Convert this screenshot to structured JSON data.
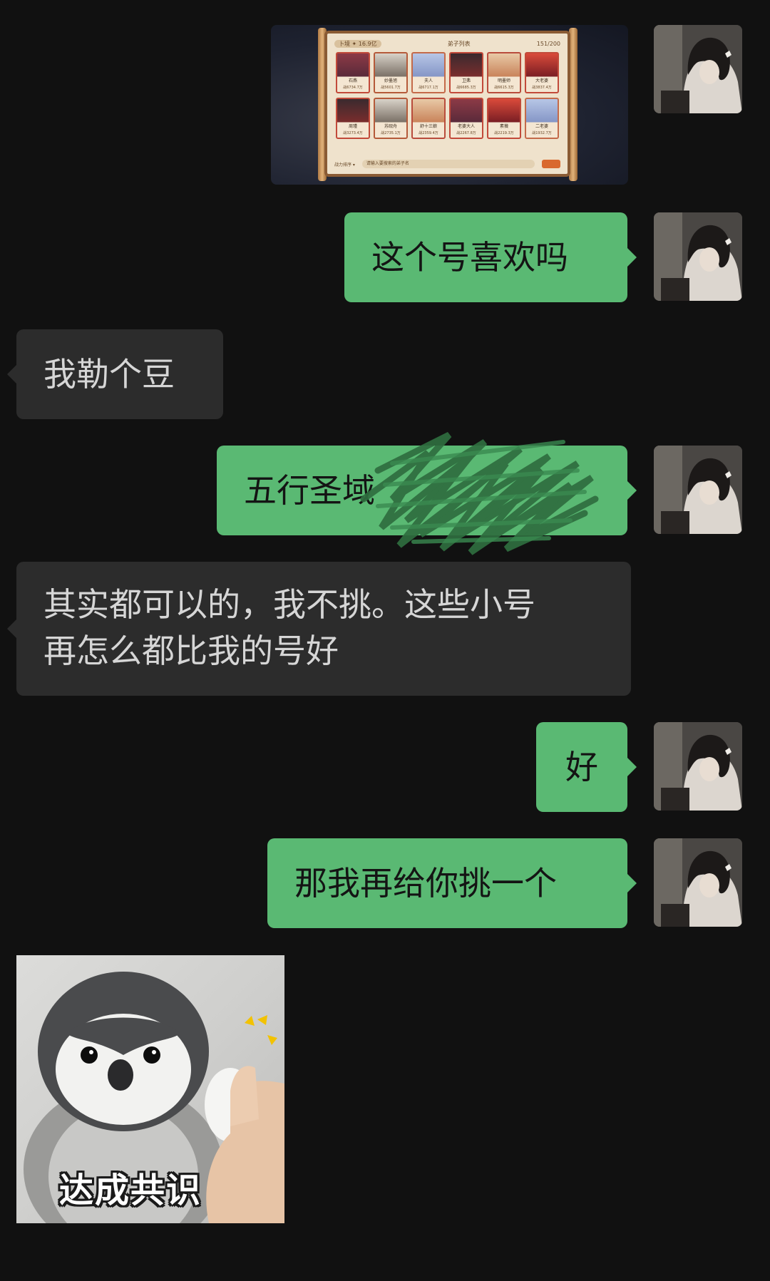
{
  "messages": {
    "m1_image": {
      "header_left": "卜境 ✦ 16.9亿",
      "header_title": "弟子列表",
      "header_right": "151/200",
      "cards": [
        {
          "name": "石燕",
          "power": "战6734.7万"
        },
        {
          "name": "妙墨旭",
          "power": "战5601.7万"
        },
        {
          "name": "夫人",
          "power": "战6717.1万"
        },
        {
          "name": "卫弗",
          "power": "战6685.3万"
        },
        {
          "name": "明墨师",
          "power": "战6615.3万"
        },
        {
          "name": "大老婆",
          "power": "战3837.4万"
        },
        {
          "name": "周瑾",
          "power": "战3273.4万"
        },
        {
          "name": "苏砚舟",
          "power": "战2735.1万"
        },
        {
          "name": "舒十三娘",
          "power": "战2359.4万"
        },
        {
          "name": "老婆大人",
          "power": "战2267.8万"
        },
        {
          "name": "素薇",
          "power": "战2219.3万"
        },
        {
          "name": "二老婆",
          "power": "战1932.7万"
        }
      ],
      "footer_sort": "战力排序 ▾",
      "footer_search": "请输入要搜索的弟子名"
    },
    "m2": "这个号喜欢吗",
    "m3": "我勒个豆",
    "m4": "五行圣域",
    "m5_line1": "其实都可以的，我不挑。这些小号",
    "m5_line2": "再怎么都比我的号好",
    "m6": "好",
    "m7": "那我再给你挑一个",
    "m8_sticker_caption": "达成共识"
  },
  "colors": {
    "background": "#111111",
    "outgoing_bubble": "#5ab973",
    "incoming_bubble": "#2c2c2c"
  }
}
